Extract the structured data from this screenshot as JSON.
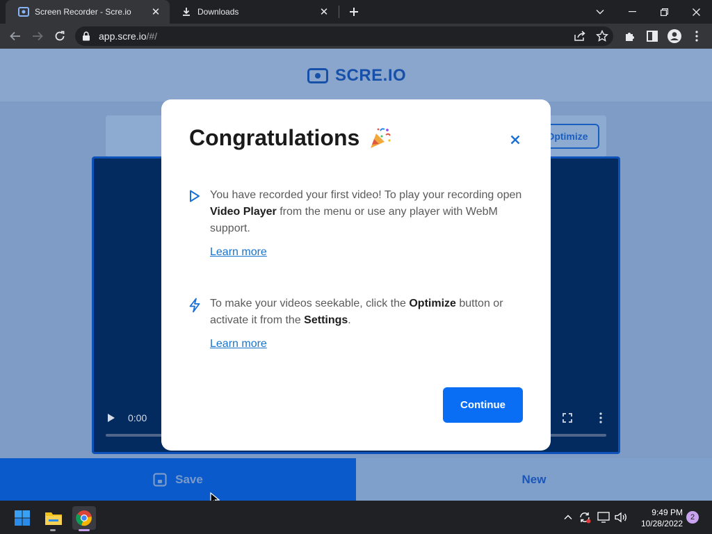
{
  "browser": {
    "tabs": [
      {
        "title": "Screen Recorder - Scre.io",
        "icon": "screen-recorder-favicon",
        "active": true
      },
      {
        "title": "Downloads",
        "icon": "download-icon",
        "active": false
      }
    ],
    "url_host": "app.scre.io",
    "url_path": "/#/"
  },
  "page": {
    "logo_text": "SCRE.IO",
    "optimize_label": "Optimize",
    "video_time": "0:00",
    "save_label": "Save",
    "new_label": "New"
  },
  "modal": {
    "title": "Congratulations",
    "item1": {
      "text_a": "You have recorded your first video! To play your recording open ",
      "bold_a": "Video Player",
      "text_b": " from the menu or use any player with WebM support.",
      "link": "Learn more"
    },
    "item2": {
      "text_a": "To make your videos seekable, click the ",
      "bold_a": "Optimize",
      "text_b": " button or activate it from the ",
      "bold_b": "Settings",
      "text_c": ".",
      "link": "Learn more"
    },
    "continue_label": "Continue"
  },
  "taskbar": {
    "time": "9:49 PM",
    "date": "10/28/2022",
    "notification_count": "2"
  },
  "colors": {
    "primary": "#0a6ef5",
    "link": "#1a73cc",
    "overlay": "#7f9cc7"
  }
}
